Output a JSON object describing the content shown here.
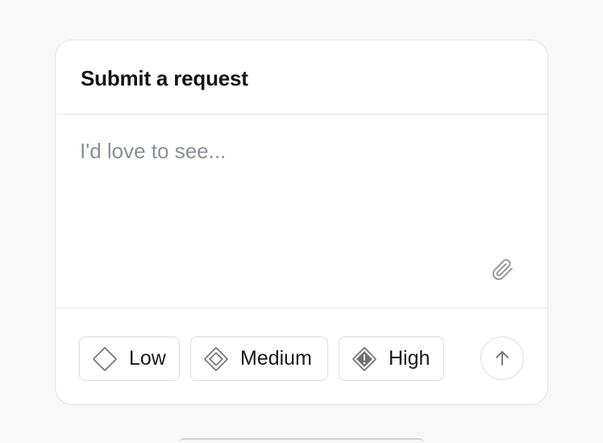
{
  "card": {
    "title": "Submit a request",
    "input": {
      "placeholder": "I'd love to see...",
      "value": ""
    },
    "attach_icon": "paperclip-icon"
  },
  "priority": {
    "options": [
      {
        "label": "Low",
        "icon": "diamond-outline-icon"
      },
      {
        "label": "Medium",
        "icon": "diamond-double-outline-icon"
      },
      {
        "label": "High",
        "icon": "diamond-alert-filled-icon"
      }
    ]
  },
  "send": {
    "icon": "arrow-up-icon"
  },
  "colors": {
    "background": "#f8f8f9",
    "card": "#ffffff",
    "border": "#e3e3e6",
    "placeholder": "#8b8f97",
    "icon_gray": "#7a7a80"
  }
}
